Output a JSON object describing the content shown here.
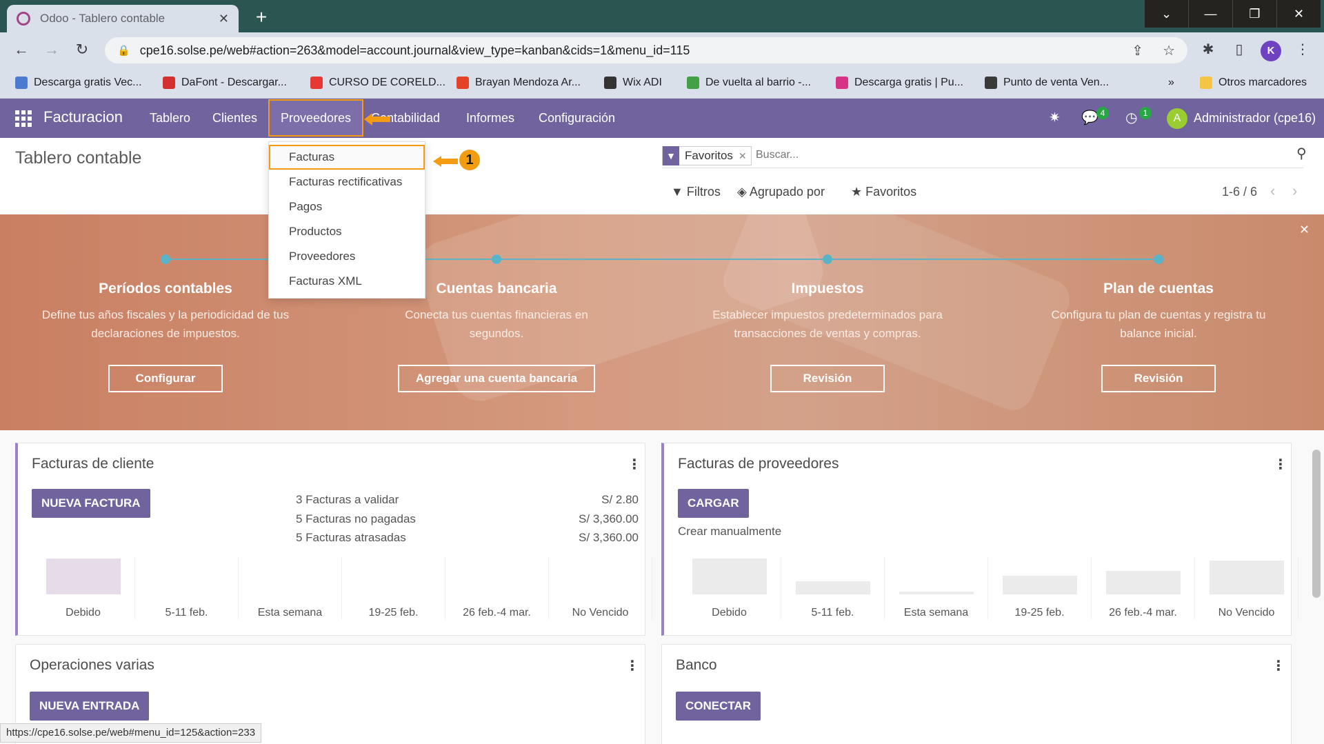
{
  "browser": {
    "tab_title": "Odoo - Tablero contable",
    "url": "cpe16.solse.pe/web#action=263&model=account.journal&view_type=kanban&cids=1&menu_id=115",
    "profile_initial": "K",
    "bookmarks": [
      {
        "label": "Descarga gratis Vec...",
        "color": "#4a7bd0"
      },
      {
        "label": "DaFont - Descargar...",
        "color": "#d32f2f"
      },
      {
        "label": "CURSO DE CORELD...",
        "color": "#e53935"
      },
      {
        "label": "Brayan Mendoza Ar...",
        "color": "#e24329"
      },
      {
        "label": "Wix ADI",
        "color": "#333333"
      },
      {
        "label": "De vuelta al barrio -...",
        "color": "#43a047"
      },
      {
        "label": "Descarga gratis | Pu...",
        "color": "#d63384"
      },
      {
        "label": "Punto de venta Ven...",
        "color": "#3a3a3a"
      }
    ],
    "bookmarks_more": "»",
    "other_bookmarks": "Otros marcadores",
    "status_url": "https://cpe16.solse.pe/web#menu_id=125&action=233"
  },
  "navbar": {
    "brand": "Facturacion",
    "menu": [
      "Tablero",
      "Clientes",
      "Proveedores",
      "Contabilidad",
      "Informes",
      "Configuración"
    ],
    "messages_count": "4",
    "activities_count": "1",
    "user_initial": "A",
    "user_name": "Administrador (cpe16)"
  },
  "control_panel": {
    "title": "Tablero contable",
    "facet_label": "Favoritos",
    "search_placeholder": "Buscar...",
    "filters": "Filtros",
    "group_by": "Agrupado por",
    "favorites": "Favoritos",
    "pager": "1-6 / 6"
  },
  "dropdown": {
    "items": [
      "Facturas",
      "Facturas rectificativas",
      "Pagos",
      "Productos",
      "Proveedores",
      "Facturas XML"
    ],
    "callout_number": "1"
  },
  "banner": {
    "steps": [
      {
        "title": "Períodos contables",
        "description": "Define tus años fiscales y la periodicidad de tus declaraciones de impuestos.",
        "button": "Configurar"
      },
      {
        "title": "Cuentas bancaria",
        "description": "Conecta tus cuentas financieras en segundos.",
        "button": "Agregar una cuenta bancaria"
      },
      {
        "title": "Impuestos",
        "description": "Establecer impuestos predeterminados para transacciones de ventas y compras.",
        "button": "Revisión"
      },
      {
        "title": "Plan de cuentas",
        "description": "Configura tu plan de cuentas y registra tu balance inicial.",
        "button": "Revisión"
      }
    ]
  },
  "cards": {
    "clientes": {
      "title": "Facturas de cliente",
      "button": "NUEVA FACTURA",
      "stats": [
        {
          "label": "3 Facturas a validar",
          "value": "S/ 2.80"
        },
        {
          "label": "5 Facturas no pagadas",
          "value": "S/ 3,360.00"
        },
        {
          "label": "5 Facturas atrasadas",
          "value": "S/ 3,360.00"
        }
      ],
      "graph": {
        "labels": [
          "Debido",
          "5-11 feb.",
          "Esta semana",
          "19-25 feb.",
          "26 feb.-4 mar.",
          "No Vencido"
        ],
        "levels": [
          1.0,
          0,
          0,
          0,
          0,
          0
        ],
        "color": "#e6dce9"
      }
    },
    "proveedores": {
      "title": "Facturas de proveedores",
      "button": "CARGAR",
      "manual": "Crear manualmente",
      "graph": {
        "labels": [
          "Debido",
          "5-11 feb.",
          "Esta semana",
          "19-25 feb.",
          "26 feb.-4 mar.",
          "No Vencido"
        ],
        "levels": [
          1.0,
          0.36,
          0.07,
          0.52,
          0.66,
          0.94
        ],
        "color": "#ebebeb"
      }
    },
    "varias": {
      "title": "Operaciones varias",
      "button": "NUEVA ENTRADA"
    },
    "banco": {
      "title": "Banco",
      "button": "CONECTAR"
    }
  }
}
